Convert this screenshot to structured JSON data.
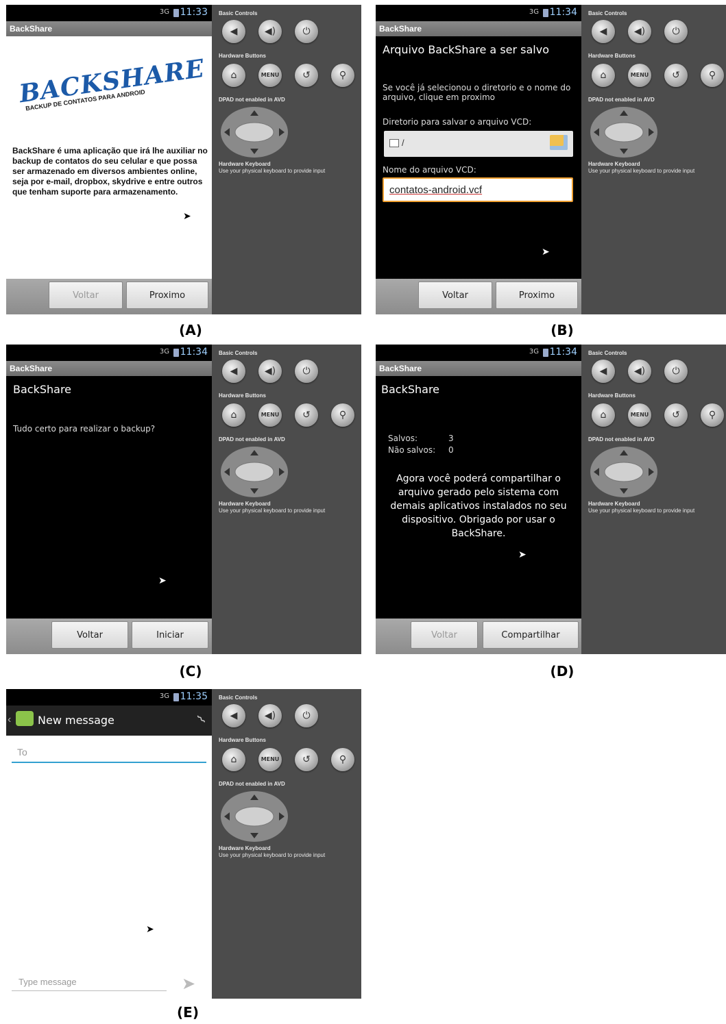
{
  "controls": {
    "basic_controls": "Basic Controls",
    "hardware_buttons": "Hardware Buttons",
    "dpad": "DPAD not enabled in AVD",
    "keyboard_title": "Hardware Keyboard",
    "keyboard_sub": "Use your physical keyboard to provide input",
    "menu": "MENU"
  },
  "signal": "3G",
  "app_title": "BackShare",
  "panels": {
    "a": {
      "time": "11:33",
      "logo_text": "BACKSHARE",
      "logo_sub": "BACKUP DE CONTATOS PARA ANDROID",
      "description": "BackShare é uma aplicação que irá lhe auxiliar no backup de contatos do seu celular e que possa ser armazenado em diversos ambientes online, seja por e-mail, dropbox, skydrive e entre outros que tenham suporte para armazenamento.",
      "back": "Voltar",
      "next": "Proximo",
      "caption": "(A)"
    },
    "b": {
      "time": "11:34",
      "heading": "Arquivo BackShare a ser salvo",
      "info": "Se você já selecionou o diretorio e o nome do arquivo, clique em proximo",
      "dir_label": "Diretorio para salvar o arquivo VCD:",
      "dir_value": "/",
      "name_label": "Nome do arquivo VCD:",
      "name_value": "contatos-android.vcf",
      "back": "Voltar",
      "next": "Proximo",
      "caption": "(B)"
    },
    "c": {
      "time": "11:34",
      "heading": "BackShare",
      "question": "Tudo certo para realizar o backup?",
      "back": "Voltar",
      "start": "Iniciar",
      "caption": "(C)"
    },
    "d": {
      "time": "11:34",
      "heading": "BackShare",
      "saved_label": "Salvos:",
      "saved_value": "3",
      "unsaved_label": "Não salvos:",
      "unsaved_value": "0",
      "message": "Agora você poderá compartilhar o arquivo gerado pelo sistema com demais aplicativos instalados no seu dispositivo. Obrigado por usar o BackShare.",
      "back": "Voltar",
      "share": "Compartilhar",
      "caption": "(D)"
    },
    "e": {
      "time": "11:35",
      "title": "New message",
      "to_placeholder": "To",
      "message_placeholder": "Type message",
      "caption": "(E)"
    }
  }
}
